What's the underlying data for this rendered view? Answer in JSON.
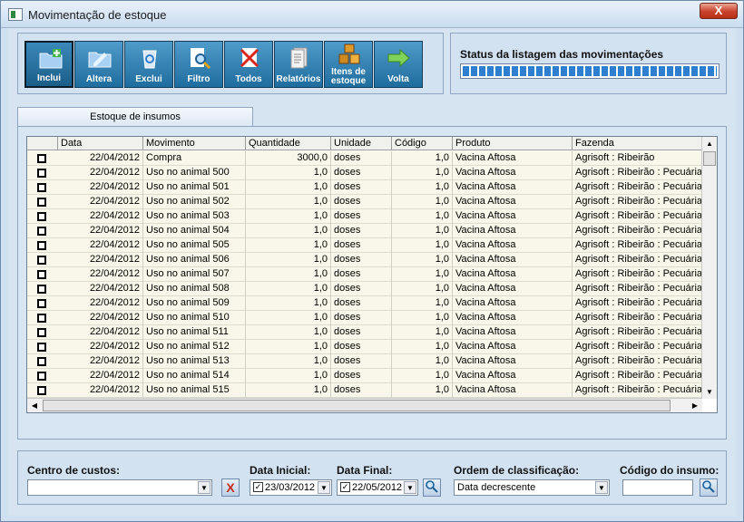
{
  "window": {
    "title": "Movimentação de estoque",
    "close_label": "X"
  },
  "toolbar": {
    "buttons": [
      {
        "label": "Inclui",
        "icon": "folder-add-icon"
      },
      {
        "label": "Altera",
        "icon": "folder-edit-icon"
      },
      {
        "label": "Exclui",
        "icon": "recycle-bin-icon"
      },
      {
        "label": "Filtro",
        "icon": "magnifier-document-icon"
      },
      {
        "label": "Todos",
        "icon": "document-cross-icon"
      },
      {
        "label": "Relatórios",
        "icon": "report-icon"
      },
      {
        "label": "Itens de estoque",
        "icon": "boxes-icon"
      },
      {
        "label": "Volta",
        "icon": "arrow-right-icon"
      }
    ]
  },
  "status": {
    "title": "Status da listagem das movimentações",
    "progress": 1.0
  },
  "tab": {
    "label": "Estoque de insumos"
  },
  "grid": {
    "columns": [
      "Data",
      "Movimento",
      "Quantidade",
      "Unidade",
      "Código",
      "Produto",
      "Fazenda"
    ],
    "rows": [
      [
        "22/04/2012",
        "Compra",
        "3000,0",
        "doses",
        "1,0",
        "Vacina Aftosa",
        "Agrisoft : Ribeirão"
      ],
      [
        "22/04/2012",
        "Uso no animal 500",
        "1,0",
        "doses",
        "1,0",
        "Vacina Aftosa",
        "Agrisoft : Ribeirão : Pecuária"
      ],
      [
        "22/04/2012",
        "Uso no animal 501",
        "1,0",
        "doses",
        "1,0",
        "Vacina Aftosa",
        "Agrisoft : Ribeirão : Pecuária"
      ],
      [
        "22/04/2012",
        "Uso no animal 502",
        "1,0",
        "doses",
        "1,0",
        "Vacina Aftosa",
        "Agrisoft : Ribeirão : Pecuária"
      ],
      [
        "22/04/2012",
        "Uso no animal 503",
        "1,0",
        "doses",
        "1,0",
        "Vacina Aftosa",
        "Agrisoft : Ribeirão : Pecuária"
      ],
      [
        "22/04/2012",
        "Uso no animal 504",
        "1,0",
        "doses",
        "1,0",
        "Vacina Aftosa",
        "Agrisoft : Ribeirão : Pecuária"
      ],
      [
        "22/04/2012",
        "Uso no animal 505",
        "1,0",
        "doses",
        "1,0",
        "Vacina Aftosa",
        "Agrisoft : Ribeirão : Pecuária"
      ],
      [
        "22/04/2012",
        "Uso no animal 506",
        "1,0",
        "doses",
        "1,0",
        "Vacina Aftosa",
        "Agrisoft : Ribeirão : Pecuária"
      ],
      [
        "22/04/2012",
        "Uso no animal 507",
        "1,0",
        "doses",
        "1,0",
        "Vacina Aftosa",
        "Agrisoft : Ribeirão : Pecuária"
      ],
      [
        "22/04/2012",
        "Uso no animal 508",
        "1,0",
        "doses",
        "1,0",
        "Vacina Aftosa",
        "Agrisoft : Ribeirão : Pecuária"
      ],
      [
        "22/04/2012",
        "Uso no animal 509",
        "1,0",
        "doses",
        "1,0",
        "Vacina Aftosa",
        "Agrisoft : Ribeirão : Pecuária"
      ],
      [
        "22/04/2012",
        "Uso no animal 510",
        "1,0",
        "doses",
        "1,0",
        "Vacina Aftosa",
        "Agrisoft : Ribeirão : Pecuária"
      ],
      [
        "22/04/2012",
        "Uso no animal 511",
        "1,0",
        "doses",
        "1,0",
        "Vacina Aftosa",
        "Agrisoft : Ribeirão : Pecuária"
      ],
      [
        "22/04/2012",
        "Uso no animal 512",
        "1,0",
        "doses",
        "1,0",
        "Vacina Aftosa",
        "Agrisoft : Ribeirão : Pecuária"
      ],
      [
        "22/04/2012",
        "Uso no animal 513",
        "1,0",
        "doses",
        "1,0",
        "Vacina Aftosa",
        "Agrisoft : Ribeirão : Pecuária"
      ],
      [
        "22/04/2012",
        "Uso no animal 514",
        "1,0",
        "doses",
        "1,0",
        "Vacina Aftosa",
        "Agrisoft : Ribeirão : Pecuária"
      ],
      [
        "22/04/2012",
        "Uso no animal 515",
        "1,0",
        "doses",
        "1,0",
        "Vacina Aftosa",
        "Agrisoft : Ribeirão : Pecuária"
      ]
    ]
  },
  "filters": {
    "cost_center_label": "Centro de custos:",
    "cost_center_value": "",
    "clear_label": "X",
    "start_date_label": "Data Inicial:",
    "start_date_value": "23/03/2012",
    "end_date_label": "Data Final:",
    "end_date_value": "22/05/2012",
    "sort_label": "Ordem de classificação:",
    "sort_value": "Data decrescente",
    "code_label": "Código do insumo:",
    "code_value": ""
  },
  "colors": {
    "accent": "#1f6d9f",
    "progress": "#2f7fd0",
    "row": "#f8f7e9"
  }
}
